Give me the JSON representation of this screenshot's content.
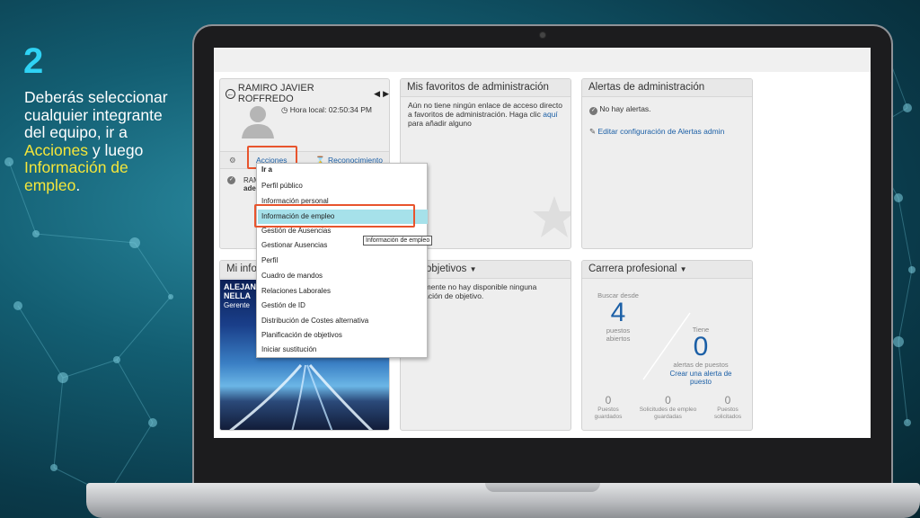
{
  "slide": {
    "step_number": "2",
    "instruction_part1": "Deberás seleccionar cualquier integrante del equipo, ir a ",
    "instruction_hl1": "Acciones",
    "instruction_part2": " y luego ",
    "instruction_hl2": "Información de empleo",
    "instruction_part3": "."
  },
  "profile": {
    "name": "RAMIRO JAVIER ROFFREDO",
    "local_time": "Hora local: 02:50:34 PM",
    "actions_tab": "Acciones",
    "recognition_tab": "Reconocimiento",
    "status_line1": "RAM",
    "status_line2": "ade"
  },
  "favorites": {
    "title": "Mis favoritos de administración",
    "text_before_link": "Aún no tiene ningún enlace de acceso directo a favoritos de administración. Haga clic ",
    "link": "aquí",
    "text_after_link": " para añadir alguno"
  },
  "alerts": {
    "title": "Alertas de administración",
    "no_alerts": "No hay alertas.",
    "edit_link": "Editar configuración de Alertas admin"
  },
  "my_info": {
    "title_partial": "Mi info",
    "person_line1": "ALEJAN",
    "person_line2": "NELLA",
    "person_line3": "Gerente"
  },
  "objectives": {
    "title_partial": "objetivos",
    "text": "almente no hay disponible ninguna\nicación de objetivo."
  },
  "career": {
    "title": "Carrera profesional",
    "search_label": "Buscar desde",
    "open_count": "4",
    "open_label": "puestos abiertos",
    "have_label": "Tiene",
    "alerts_count": "0",
    "alerts_label": "alertas de puestos",
    "create_alert_link": "Crear una alerta de puesto",
    "stats": [
      {
        "value": "0",
        "label": "Puestos guardados"
      },
      {
        "value": "0",
        "label": "Solicitudes de empleo guardadas"
      },
      {
        "value": "0",
        "label": "Puestos solicitados"
      }
    ]
  },
  "menu": {
    "header": "Ir a",
    "items": [
      "Perfil público",
      "Información personal",
      "Información de empleo",
      "Gestión de Ausencias",
      "Gestionar Ausencias",
      "Perfil",
      "Cuadro de mandos",
      "Relaciones Laborales",
      "Gestión de ID",
      "Distribución de Costes alternativa",
      "Planificación de objetivos",
      "Iniciar sustitución"
    ],
    "selected_index": 2,
    "tooltip": "Información de empleo"
  },
  "colors": {
    "accent_number": "#2fd3f5",
    "highlight_text": "#f5e63a",
    "callout_border": "#e8542d",
    "menu_highlight": "#a6e1ea",
    "link": "#1b5fa6"
  }
}
